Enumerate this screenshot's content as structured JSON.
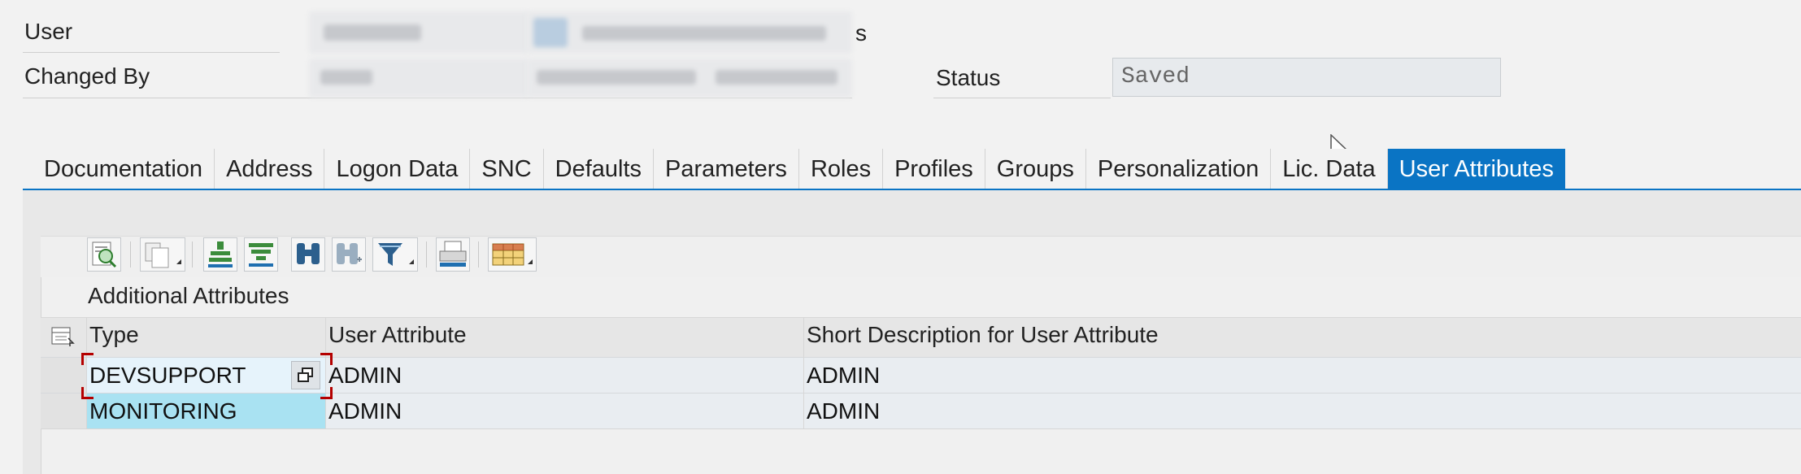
{
  "header": {
    "user_label": "User",
    "user_name_suffix": "s",
    "changed_by_label": "Changed By",
    "status_label": "Status",
    "status_value": "Saved"
  },
  "tabs": [
    {
      "label": "Documentation",
      "active": false
    },
    {
      "label": "Address",
      "active": false
    },
    {
      "label": "Logon Data",
      "active": false
    },
    {
      "label": "SNC",
      "active": false
    },
    {
      "label": "Defaults",
      "active": false
    },
    {
      "label": "Parameters",
      "active": false
    },
    {
      "label": "Roles",
      "active": false
    },
    {
      "label": "Profiles",
      "active": false
    },
    {
      "label": "Groups",
      "active": false
    },
    {
      "label": "Personalization",
      "active": false
    },
    {
      "label": "Lic. Data",
      "active": false
    },
    {
      "label": "User Attributes",
      "active": true
    }
  ],
  "toolbar": {
    "icons": [
      "details-icon",
      "copy-icon",
      "sort-ascending-icon",
      "sort-descending-icon",
      "find-icon",
      "find-next-icon",
      "filter-icon",
      "print-icon",
      "layout-icon"
    ]
  },
  "grid": {
    "title": "Additional Attributes",
    "columns": [
      "Type",
      "User Attribute",
      "Short Description for User Attribute"
    ],
    "rows": [
      {
        "type": "DEVSUPPORT",
        "attribute": "ADMIN",
        "description": "ADMIN"
      },
      {
        "type": "MONITORING",
        "attribute": "ADMIN",
        "description": "ADMIN"
      }
    ]
  },
  "colors": {
    "accent": "#0a74c4",
    "selected_cell": "#a9e2f2",
    "focus_corner": "#b40000"
  }
}
